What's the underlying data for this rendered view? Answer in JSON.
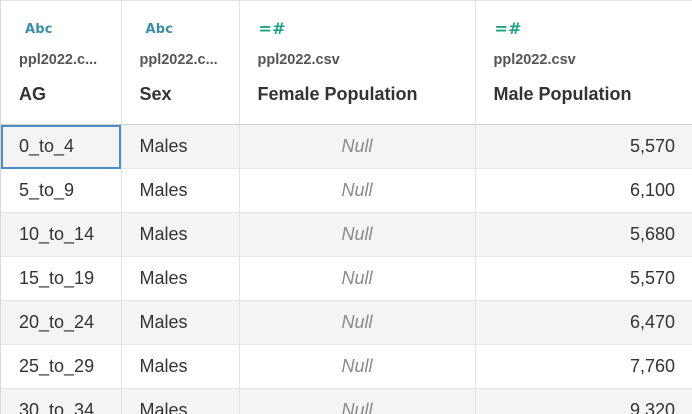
{
  "columns": [
    {
      "type_icon": "Abc",
      "source": "ppl2022.c...",
      "name": "AG"
    },
    {
      "type_icon": "Abc",
      "source": "ppl2022.c...",
      "name": "Sex"
    },
    {
      "type_icon": "=#",
      "source": "ppl2022.csv",
      "name": "Female Population"
    },
    {
      "type_icon": "=#",
      "source": "ppl2022.csv",
      "name": "Male Population"
    }
  ],
  "rows": [
    {
      "ag": "0_to_4",
      "sex": "Males",
      "female": "Null",
      "male": "5,570"
    },
    {
      "ag": "5_to_9",
      "sex": "Males",
      "female": "Null",
      "male": "6,100"
    },
    {
      "ag": "10_to_14",
      "sex": "Males",
      "female": "Null",
      "male": "5,680"
    },
    {
      "ag": "15_to_19",
      "sex": "Males",
      "female": "Null",
      "male": "5,570"
    },
    {
      "ag": "20_to_24",
      "sex": "Males",
      "female": "Null",
      "male": "6,470"
    },
    {
      "ag": "25_to_29",
      "sex": "Males",
      "female": "Null",
      "male": "7,760"
    },
    {
      "ag": "30_to_34",
      "sex": "Males",
      "female": "Null",
      "male": "9,320"
    }
  ],
  "colors": {
    "string_icon": "#3a8fa5",
    "number_icon": "#1aa587",
    "selection": "#4c8cc9",
    "row_shade": "#f4f4f4"
  }
}
